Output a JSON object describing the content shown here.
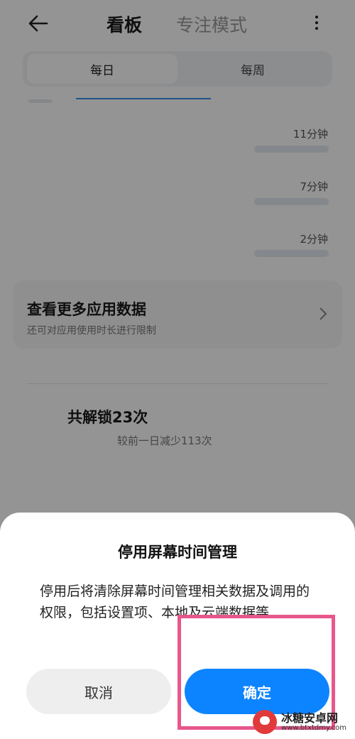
{
  "header": {
    "tabs": [
      {
        "label": "看板",
        "active": true
      },
      {
        "label": "专注模式",
        "active": false
      }
    ]
  },
  "segment": {
    "daily": "每日",
    "weekly": "每周",
    "selected": "每日"
  },
  "usage_items": [
    {
      "duration": "11分钟"
    },
    {
      "duration": "7分钟"
    },
    {
      "duration": "2分钟"
    }
  ],
  "more_card": {
    "title": "查看更多应用数据",
    "subtitle": "还可对应用使用时长进行限制"
  },
  "unlock": {
    "title": "共解锁23次",
    "subtitle": "较前一日减少113次"
  },
  "dialog": {
    "title": "停用屏幕时间管理",
    "message": "停用后将清除屏幕时间管理相关数据及调用的权限，包括设置项、本地及云端数据等",
    "cancel_label": "取消",
    "confirm_label": "确定"
  },
  "watermark": {
    "name": "冰糖安卓网",
    "url": "www.btxtdmy.com"
  },
  "colors": {
    "accent": "#0d84ff",
    "highlight": "#e7578b"
  }
}
